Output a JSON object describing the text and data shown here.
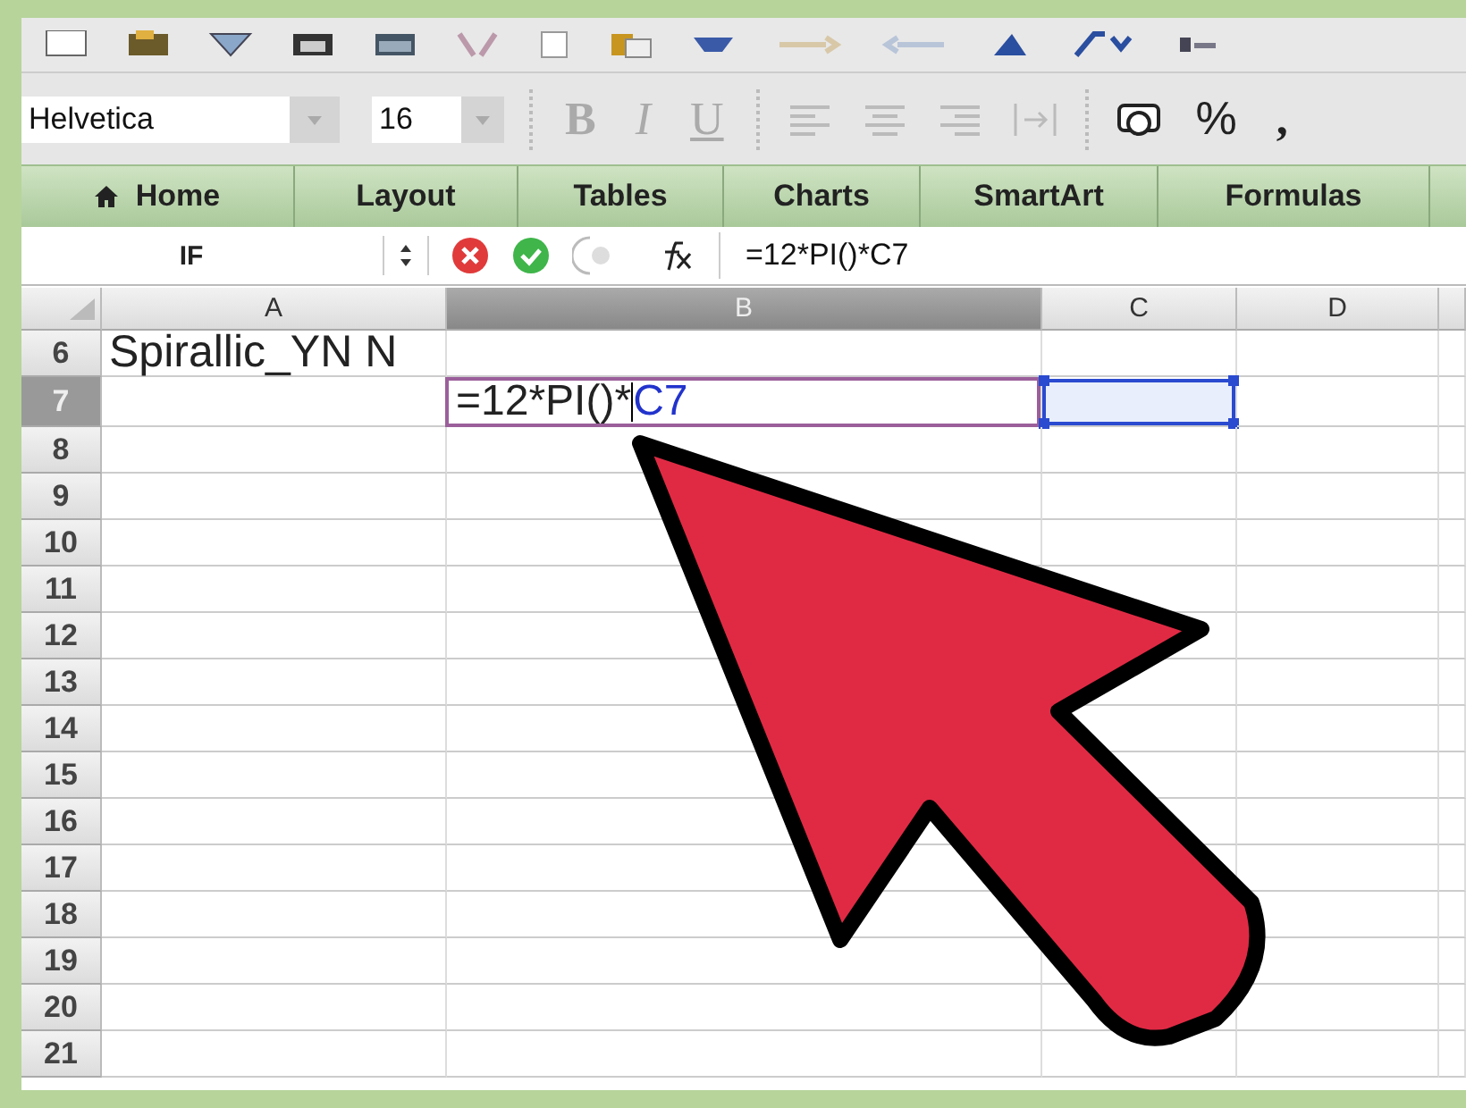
{
  "format_toolbar": {
    "font_name": "Helvetica",
    "font_size": "16",
    "buttons": [
      {
        "kind": "text",
        "label": "B",
        "disabled": true
      },
      {
        "kind": "text",
        "label": "I",
        "disabled": true
      },
      {
        "kind": "text",
        "label": "U",
        "disabled": true
      },
      {
        "kind": "icon",
        "disabled": true
      },
      {
        "kind": "icon",
        "disabled": true
      },
      {
        "kind": "icon",
        "disabled": true
      },
      {
        "kind": "icon",
        "disabled": true
      },
      {
        "kind": "icon",
        "disabled": false
      },
      {
        "kind": "text",
        "label": "%",
        "disabled": false
      },
      {
        "kind": "text",
        "label": ",",
        "disabled": false
      }
    ]
  },
  "tabs": [
    {
      "label": "Home"
    },
    {
      "label": "Layout"
    },
    {
      "label": "Tables"
    },
    {
      "label": "Charts"
    },
    {
      "label": "SmartArt"
    },
    {
      "label": "Formulas"
    }
  ],
  "formula_bar": {
    "name_box": "IF",
    "formula": "=12*PI()*C7"
  },
  "sheet": {
    "columns": [
      {
        "label": "A",
        "selected": false
      },
      {
        "label": "B",
        "selected": true
      },
      {
        "label": "C",
        "selected": false
      },
      {
        "label": "D",
        "selected": false
      }
    ],
    "rows": [
      {
        "label": "6",
        "selected": false,
        "cells": [
          {
            "kind": "text",
            "text": "Spirallic_YN N"
          }
        ]
      },
      {
        "label": "7",
        "selected": true,
        "cells": [
          {
            "kind": "empty"
          },
          {
            "kind": "editing",
            "text": "=12*PI()*",
            "reference": "C7"
          },
          {
            "kind": "reference"
          }
        ]
      },
      {
        "label": "8",
        "selected": false
      },
      {
        "label": "9",
        "selected": false
      },
      {
        "label": "10",
        "selected": false
      },
      {
        "label": "11",
        "selected": false
      },
      {
        "label": "12",
        "selected": false
      },
      {
        "label": "13",
        "selected": false
      },
      {
        "label": "14",
        "selected": false
      },
      {
        "label": "15",
        "selected": false
      },
      {
        "label": "16",
        "selected": false
      },
      {
        "label": "17",
        "selected": false
      },
      {
        "label": "18",
        "selected": false
      },
      {
        "label": "19",
        "selected": false
      },
      {
        "label": "20",
        "selected": false
      },
      {
        "label": "21",
        "selected": false
      }
    ]
  }
}
